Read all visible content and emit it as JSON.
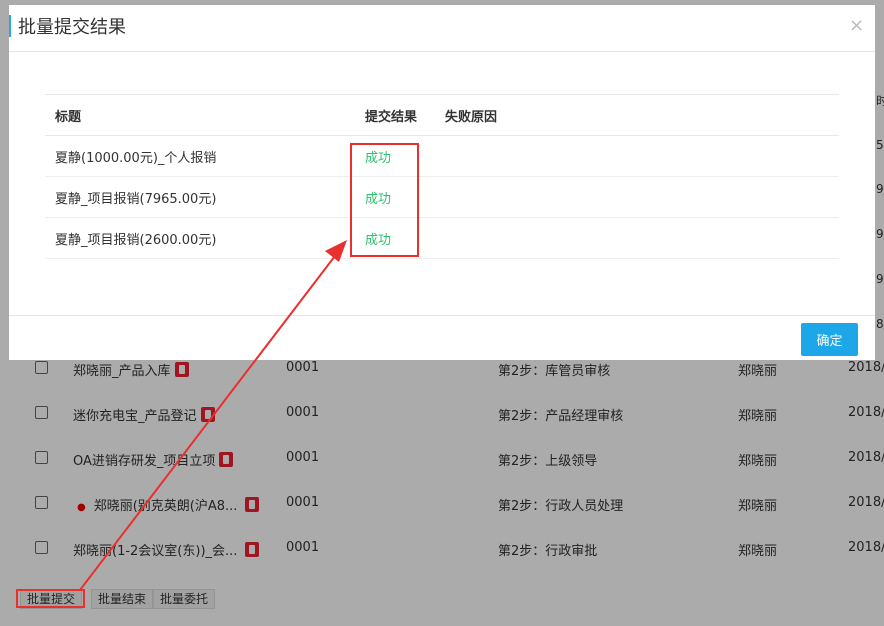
{
  "modal": {
    "title": "批量提交结果",
    "close_glyph": "×",
    "columns": [
      "标题",
      "提交结果",
      "失败原因"
    ],
    "rows": [
      {
        "title": "夏静(1000.00元)_个人报销",
        "result": "成功",
        "reason": ""
      },
      {
        "title": "夏静_项目报销(7965.00元)",
        "result": "成功",
        "reason": ""
      },
      {
        "title": "夏静_项目报销(2600.00元)",
        "result": "成功",
        "reason": ""
      }
    ],
    "confirm_label": "确定"
  },
  "background": {
    "right_clipped": [
      "时",
      "5:",
      "9/",
      "9/",
      "9/",
      "8/"
    ],
    "rows": [
      {
        "title": "郑晓丽_产品入库",
        "code": "0001",
        "step": "第2步：库管员审核",
        "person": "郑晓丽",
        "date": "2018/"
      },
      {
        "title": "迷你充电宝_产品登记",
        "code": "0001",
        "step": "第2步：产品经理审核",
        "person": "郑晓丽",
        "date": "2018/"
      },
      {
        "title": "OA进销存研发_项目立项",
        "code": "0001",
        "step": "第2步：上级领导",
        "person": "郑晓丽",
        "date": "2018/"
      },
      {
        "title": "郑晓丽(别克英朗(沪A8...",
        "code": "0001",
        "step": "第2步：行政人员处理",
        "person": "郑晓丽",
        "date": "2018/",
        "dot": "●"
      },
      {
        "title": "郑晓丽(1-2会议室(东))_会...",
        "code": "0001",
        "step": "第2步：行政审批",
        "person": "郑晓丽",
        "date": "2018/"
      }
    ],
    "actions": [
      "批量提交",
      "批量结束",
      "批量委托"
    ]
  },
  "colors": {
    "success": "#2cc36b",
    "primary": "#1ea7e8",
    "annotation": "#e8302f",
    "flag": "#e22233"
  }
}
